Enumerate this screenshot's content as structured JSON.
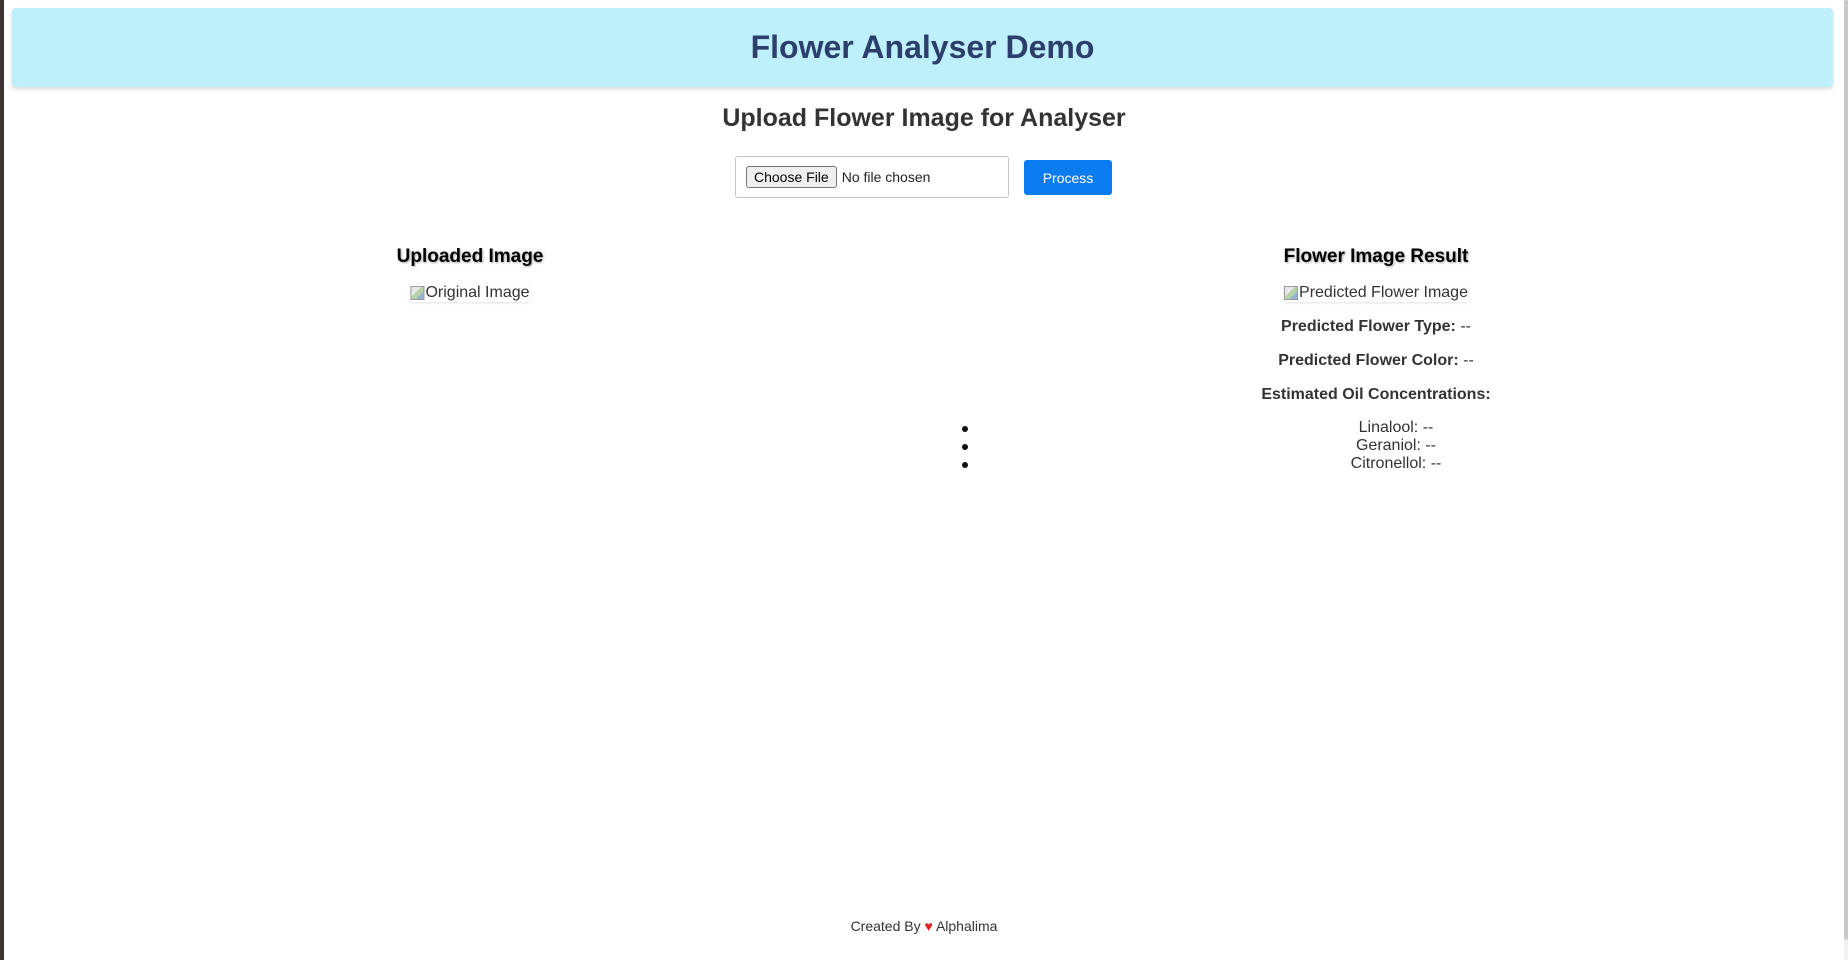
{
  "header": {
    "title": "Flower Analyser Demo"
  },
  "upload": {
    "title": "Upload Flower Image for Analyser",
    "choose_file_label": "Choose File",
    "no_file_text": "No file chosen",
    "process_label": "Process"
  },
  "uploaded": {
    "title": "Uploaded Image",
    "image_alt": "Original Image"
  },
  "result": {
    "title": "Flower Image Result",
    "image_alt": "Predicted Flower Image",
    "type_label": "Predicted Flower Type:",
    "type_value": "--",
    "color_label": "Predicted Flower Color:",
    "color_value": "--",
    "oil_heading": "Estimated Oil Concentrations:",
    "oils": [
      {
        "text": "Linalool: --"
      },
      {
        "text": "Geraniol: --"
      },
      {
        "text": "Citronellol: --"
      }
    ]
  },
  "footer": {
    "created_by": "Created By",
    "heart": "♥",
    "author": "Alphalima"
  },
  "colors": {
    "header_bg": "#bdf0fb",
    "title_color": "#2c3e6b",
    "process_button": "#0b7cf0",
    "heart": "#e02424"
  }
}
